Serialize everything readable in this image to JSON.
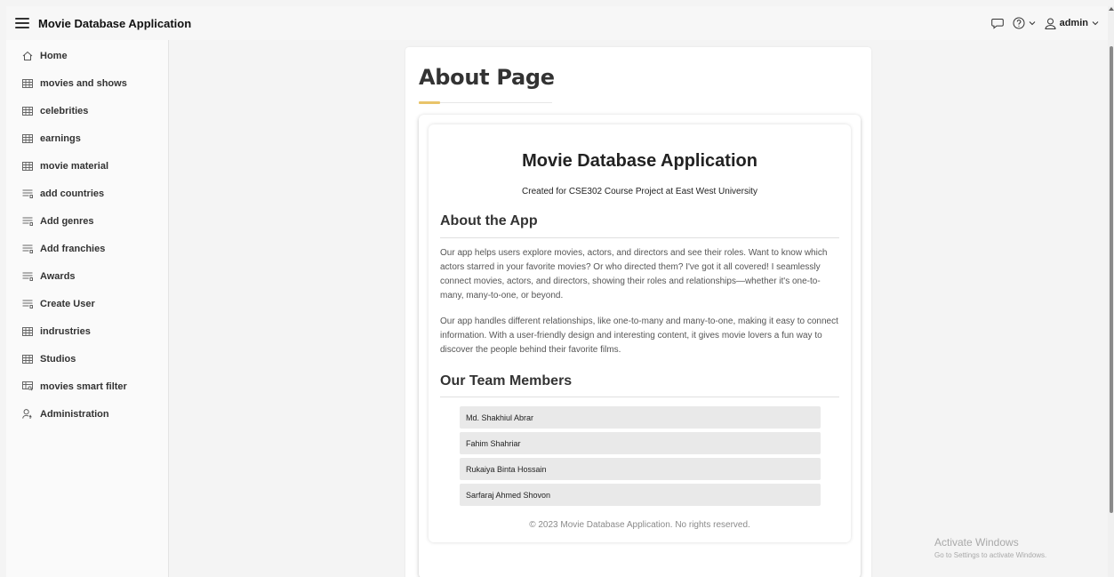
{
  "header": {
    "app_title": "Movie Database Application",
    "user_name": "admin",
    "icons": [
      "hamburger-icon",
      "chat-icon",
      "help-icon",
      "chevron-down-icon",
      "user-icon"
    ]
  },
  "sidebar": {
    "items": [
      {
        "label": "Home",
        "icon": "home-icon"
      },
      {
        "label": "movies and shows",
        "icon": "table-icon"
      },
      {
        "label": "celebrities",
        "icon": "table-icon"
      },
      {
        "label": "earnings",
        "icon": "table-icon"
      },
      {
        "label": "movie material",
        "icon": "table-icon"
      },
      {
        "label": "add countries",
        "icon": "form-icon"
      },
      {
        "label": "Add genres",
        "icon": "form-icon"
      },
      {
        "label": "Add franchies",
        "icon": "form-icon"
      },
      {
        "label": "Awards",
        "icon": "form-icon"
      },
      {
        "label": "Create User",
        "icon": "form-icon"
      },
      {
        "label": "indrustries",
        "icon": "table-icon"
      },
      {
        "label": "Studios",
        "icon": "table-icon"
      },
      {
        "label": "movies smart filter",
        "icon": "smart-filter-icon"
      },
      {
        "label": "Administration",
        "icon": "admin-icon"
      }
    ]
  },
  "main": {
    "page_title": "About Page",
    "app_heading": "Movie Database Application",
    "subtitle": "Created for CSE302 Course Project at East West University",
    "about_heading": "About the App",
    "about_paragraphs": [
      "Our app helps users explore movies, actors, and directors and see their roles. Want to know which actors starred in your favorite movies? Or who directed them? I've got it all covered! I seamlessly connect movies, actors, and directors, showing their roles and relationships—whether it's one-to-many, many-to-one, or beyond.",
      "Our app handles different relationships, like one-to-many and many-to-one, making it easy to connect information. With a user-friendly design and interesting content, it gives movie lovers a fun way to discover the people behind their favorite films."
    ],
    "team_heading": "Our Team Members",
    "team_members": [
      "Md. Shakhiul Abrar",
      "Fahim Shahriar",
      "Rukaiya Binta Hossain",
      "Sarfaraj Ahmed Shovon"
    ],
    "footer": "© 2023 Movie Database Application. No rights reserved."
  },
  "watermark": {
    "title": "Activate Windows",
    "subtitle": "Go to Settings to activate Windows."
  },
  "colors": {
    "accent": "#e9c46a",
    "header_bg": "#f7f7f7",
    "member_bg": "#e9e9e9"
  }
}
